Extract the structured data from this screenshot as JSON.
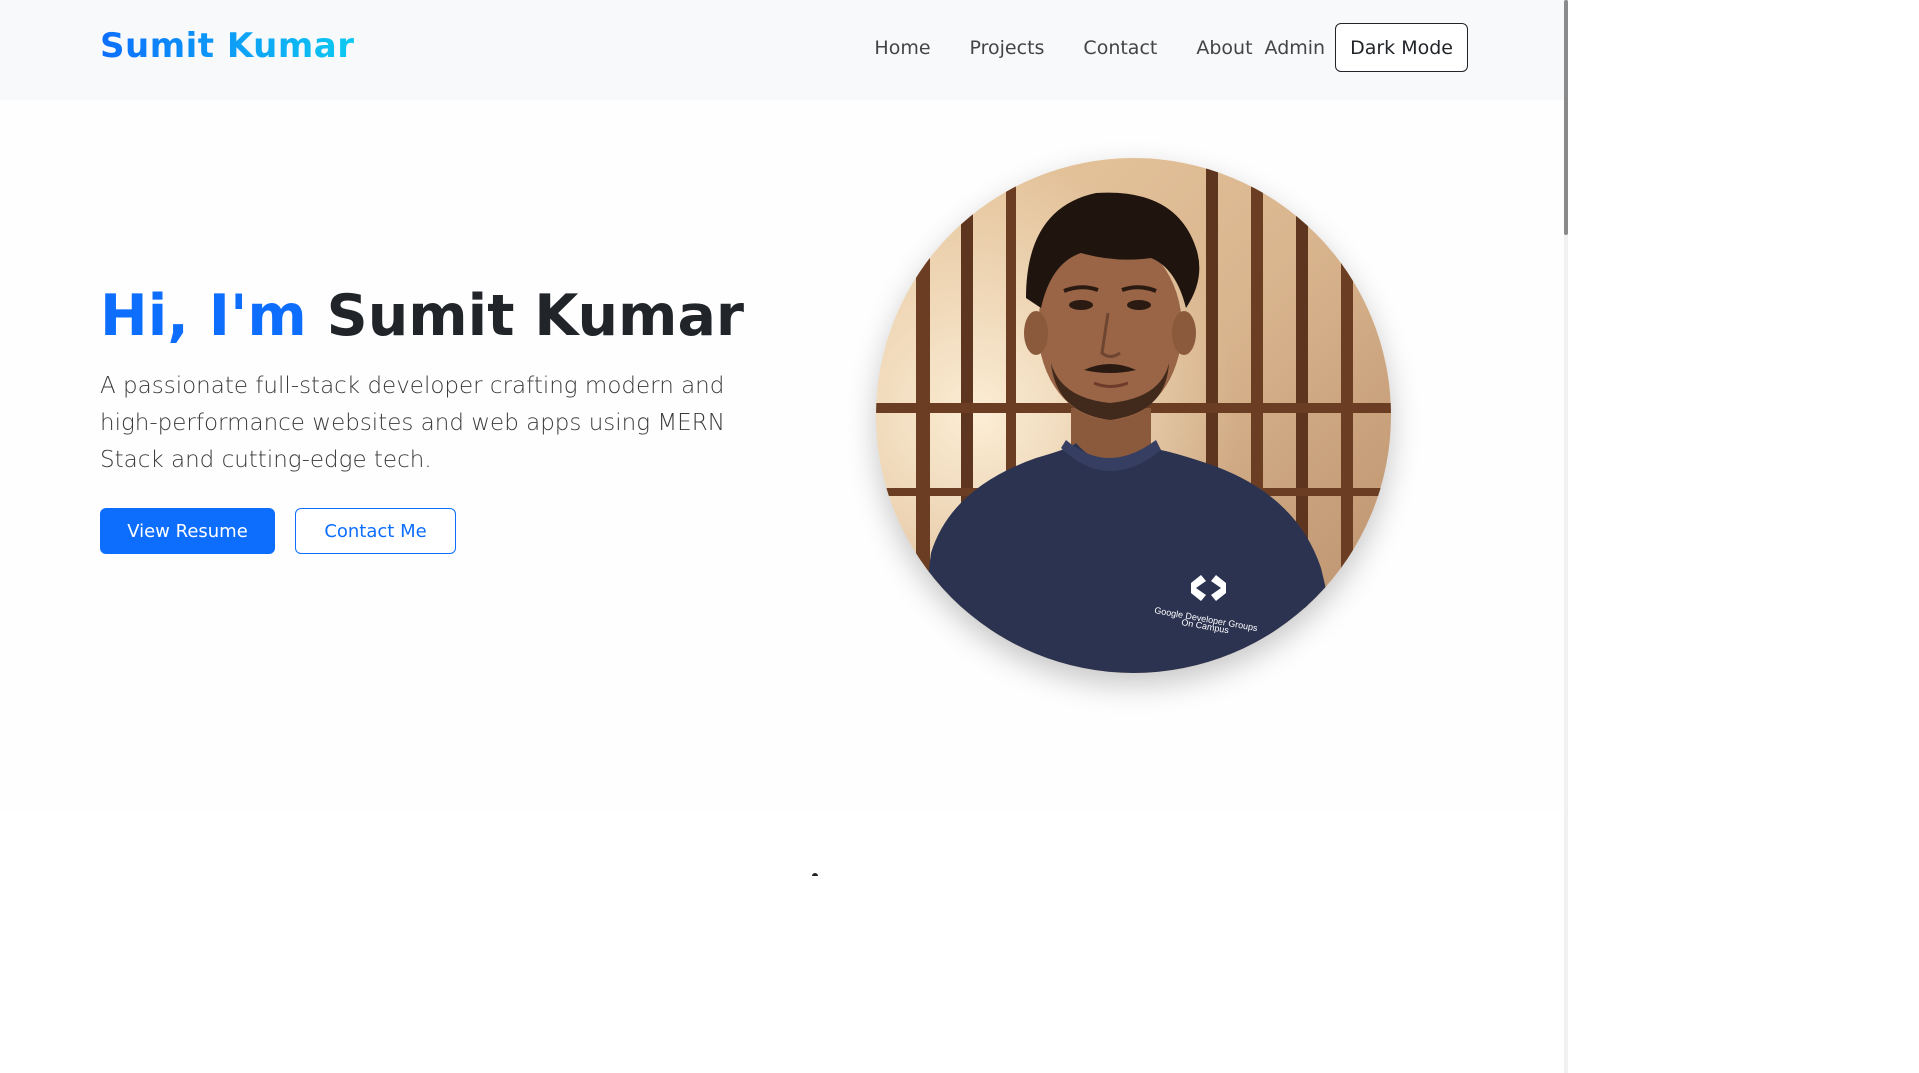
{
  "navbar": {
    "brand": "Sumit Kumar",
    "links": [
      {
        "label": "Home"
      },
      {
        "label": "Projects"
      },
      {
        "label": "Contact"
      },
      {
        "label": "About"
      },
      {
        "label": "Admin"
      }
    ],
    "dark_mode_label": "Dark Mode"
  },
  "hero": {
    "greeting": "Hi, I'm",
    "name": "Sumit Kumar",
    "description": "A passionate full-stack developer crafting modern and high-performance websites and web apps using MERN Stack and cutting-edge tech.",
    "primary_button": "View Resume",
    "secondary_button": "Contact Me"
  },
  "profile_photo": {
    "shirt_logo_line1": "Google Developer Groups",
    "shirt_logo_line2": "On Campus"
  },
  "colors": {
    "accent": "#0d6efd",
    "navbar_bg": "#f8f9fa",
    "text_dark": "#212529"
  }
}
